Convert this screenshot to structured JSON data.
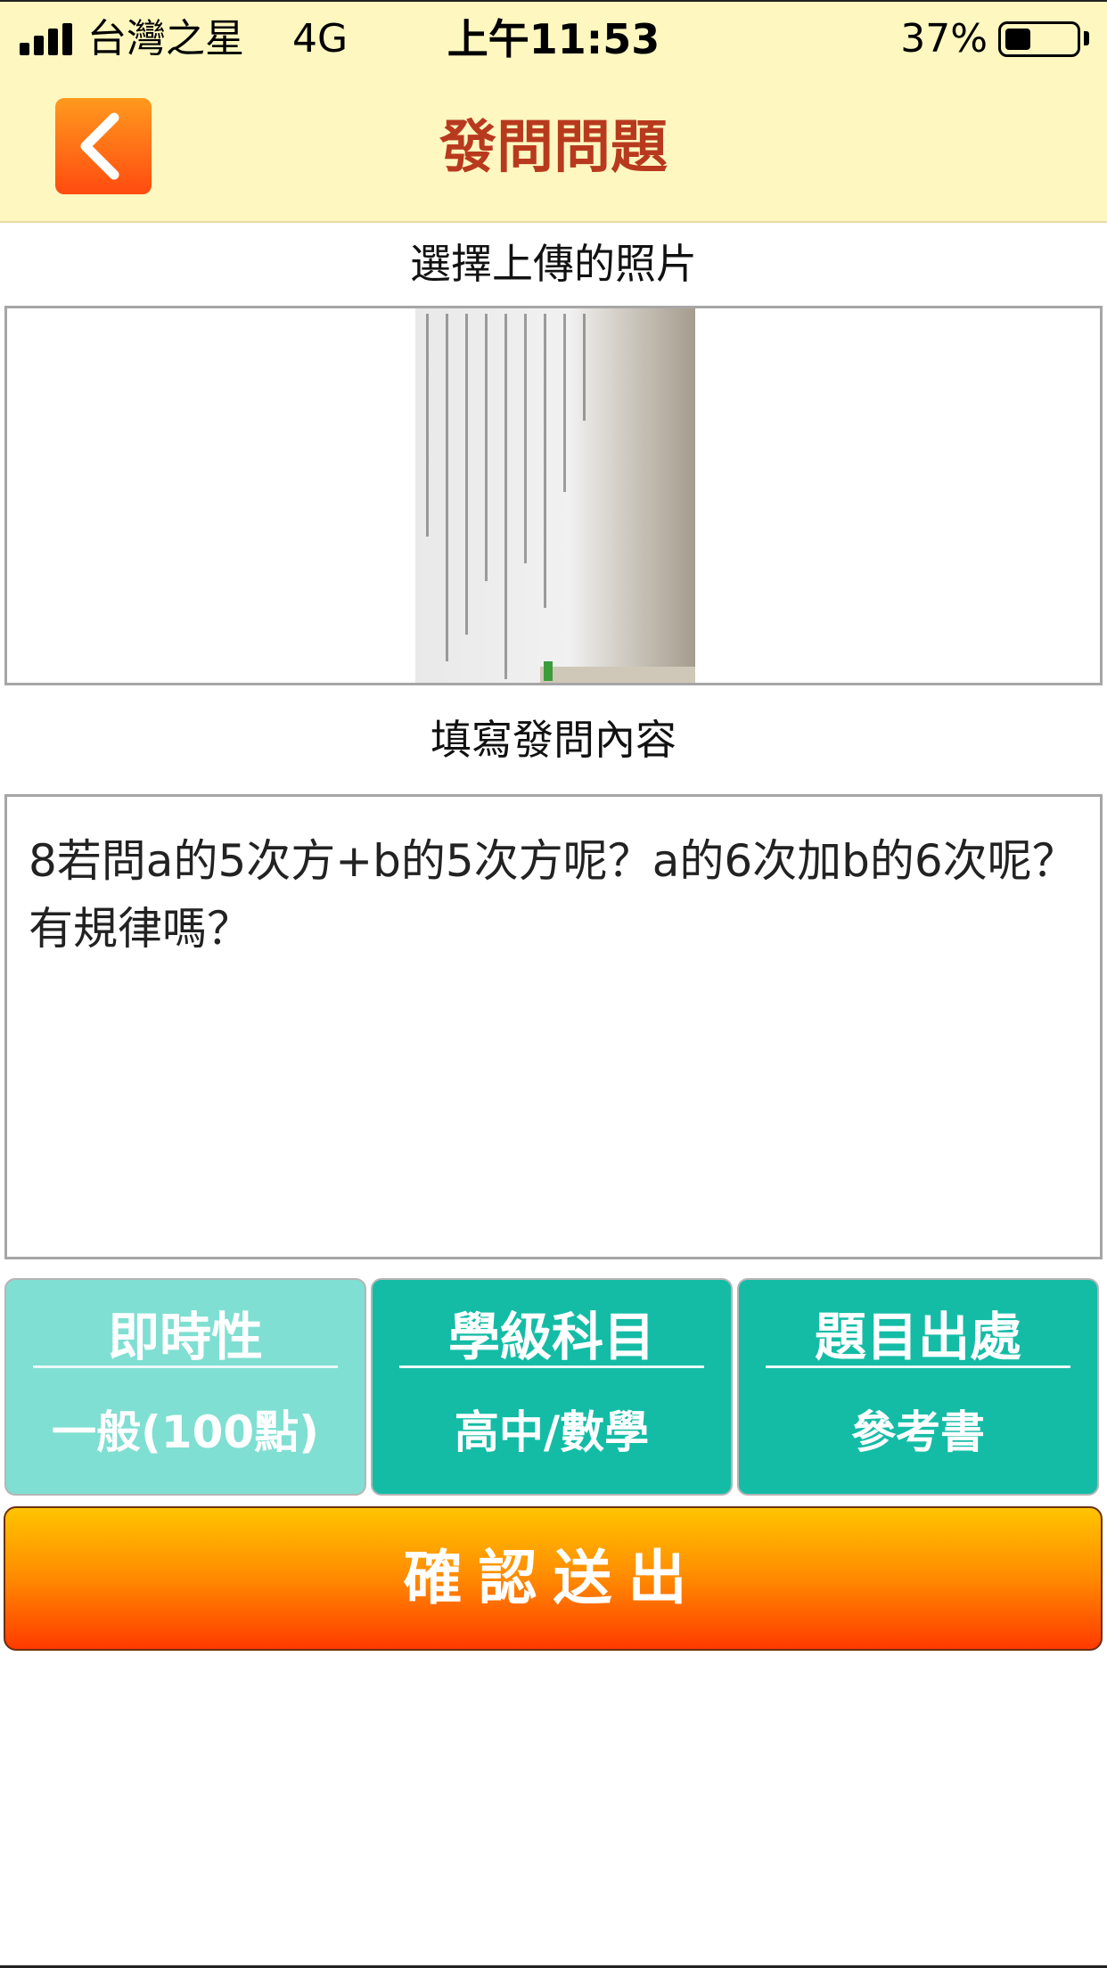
{
  "status_bar": {
    "carrier": "台灣之星",
    "network": "4G",
    "time": "上午11:53",
    "battery_percent": "37%",
    "battery_level": 0.37
  },
  "header": {
    "title": "發問問題",
    "back_icon": "chevron-left-icon",
    "accent_color": "#ff6a14"
  },
  "photo_section": {
    "label": "選擇上傳的照片"
  },
  "content_section": {
    "label": "填寫發問內容",
    "question_text": "8若問a的5次方+b的5次方呢？a的6次加b的6次呢？有規律嗎？"
  },
  "options": [
    {
      "title": "即時性",
      "value": "一般(100點)"
    },
    {
      "title": "學級科目",
      "value": "高中/數學"
    },
    {
      "title": "題目出處",
      "value": "參考書"
    }
  ],
  "submit": {
    "label": "確認送出"
  }
}
